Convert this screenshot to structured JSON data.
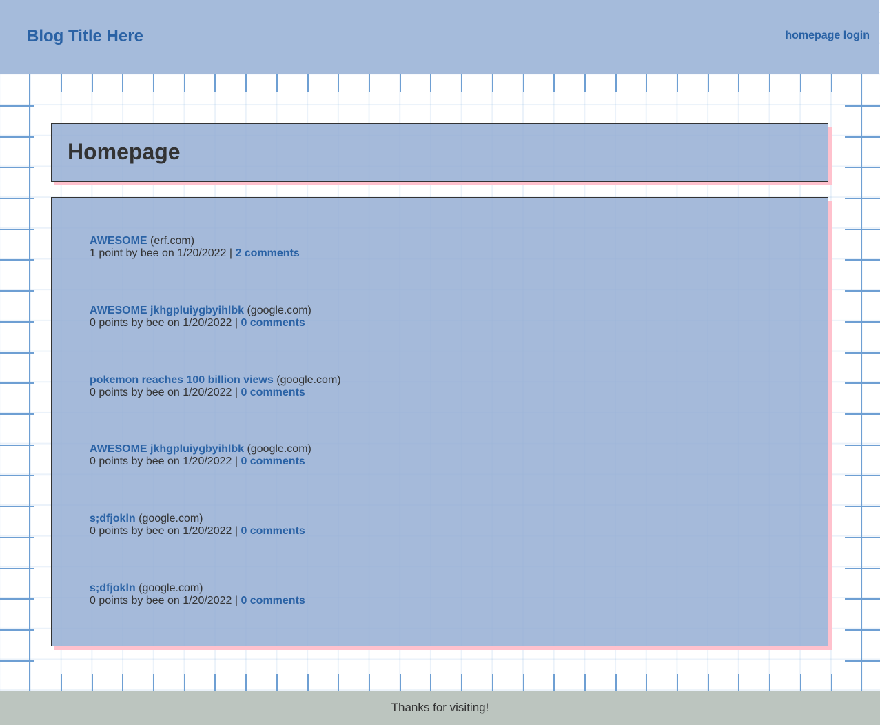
{
  "header": {
    "blog_title": "Blog Title Here",
    "nav_homepage": "homepage",
    "nav_login": "login"
  },
  "page": {
    "title": "Homepage"
  },
  "posts": [
    {
      "title": "AWESOME",
      "domain": "(erf.com)",
      "meta": "1 point by bee on 1/20/2022 | ",
      "comments": "2 comments"
    },
    {
      "title": "AWESOME jkhgpluiygbyihlbk",
      "domain": "(google.com)",
      "meta": "0 points by bee on 1/20/2022 | ",
      "comments": "0 comments"
    },
    {
      "title": "pokemon reaches 100 billion views",
      "domain": "(google.com)",
      "meta": "0 points by bee on 1/20/2022 | ",
      "comments": "0 comments"
    },
    {
      "title": "AWESOME jkhgpluiygbyihlbk",
      "domain": "(google.com)",
      "meta": "0 points by bee on 1/20/2022 | ",
      "comments": "0 comments"
    },
    {
      "title": "s;dfjokln",
      "domain": "(google.com)",
      "meta": "0 points by bee on 1/20/2022 | ",
      "comments": "0 comments"
    },
    {
      "title": "s;dfjokln",
      "domain": "(google.com)",
      "meta": "0 points by bee on 1/20/2022 | ",
      "comments": "0 comments"
    }
  ],
  "footer": {
    "text": "Thanks for visiting!"
  },
  "colors": {
    "header_bg": "#a5bbdb",
    "link": "#2a62a5",
    "card_shadow": "#ffc1cd",
    "footer_bg": "#bcc5bf",
    "grid_line": "#6e9fd3"
  }
}
